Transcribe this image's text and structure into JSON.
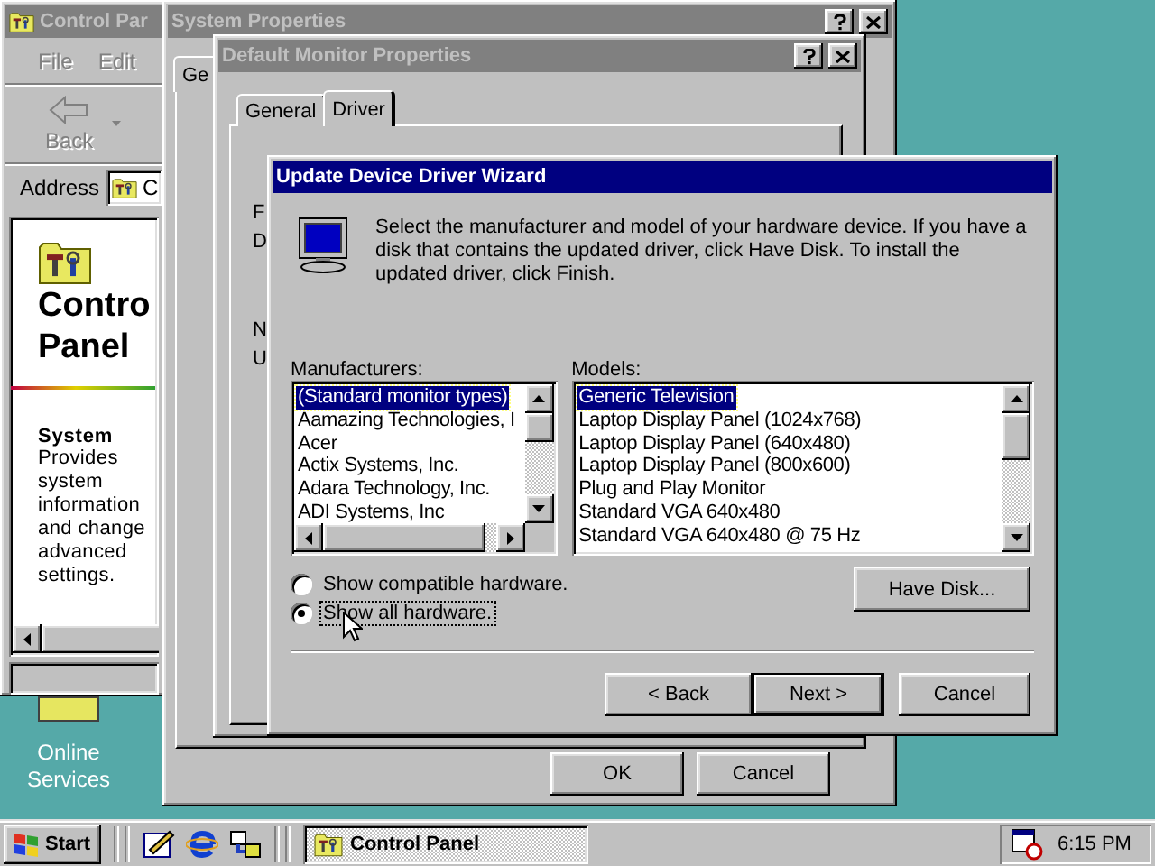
{
  "desktop": {
    "icons": [
      {
        "label": "Online Services"
      }
    ]
  },
  "control_panel": {
    "title": "Control Par",
    "menu": [
      {
        "label": "File",
        "disabled": true
      },
      {
        "label": "Edit",
        "disabled": true
      }
    ],
    "toolbar": [
      {
        "label": "Back",
        "disabled": true
      }
    ],
    "address_label": "Address",
    "address_value": "C",
    "heading": [
      "Contro",
      "Panel"
    ],
    "item_title": "System",
    "item_description": "Provides system information and change advanced settings."
  },
  "system_properties": {
    "title": "System Properties",
    "tabs": [
      {
        "label": "Ge",
        "selected": true
      }
    ],
    "buttons": [
      "OK",
      "Cancel"
    ]
  },
  "monitor_properties": {
    "title": "Default Monitor Properties",
    "tabs": [
      {
        "label": "General",
        "selected": false
      },
      {
        "label": "Driver",
        "selected": true
      }
    ],
    "fragments": [
      "F",
      "D",
      "N",
      "U"
    ]
  },
  "wizard": {
    "title": "Update Device Driver Wizard",
    "instructions": "Select the manufacturer and model of your hardware device. If you have a disk that contains the updated driver, click Have Disk. To install the updated driver, click Finish.",
    "manufacturers": {
      "label": "Manufacturers:",
      "items": [
        {
          "text": "(Standard monitor types)",
          "selected": true
        },
        {
          "text": "Aamazing Technologies, I",
          "selected": false
        },
        {
          "text": "Acer",
          "selected": false
        },
        {
          "text": "Actix Systems, Inc.",
          "selected": false
        },
        {
          "text": "Adara Technology, Inc.",
          "selected": false
        },
        {
          "text": "ADI Systems, Inc",
          "selected": false
        }
      ]
    },
    "models": {
      "label": "Models:",
      "items": [
        {
          "text": "Generic Television",
          "selected": true
        },
        {
          "text": "Laptop Display Panel (1024x768)",
          "selected": false
        },
        {
          "text": "Laptop Display Panel (640x480)",
          "selected": false
        },
        {
          "text": "Laptop Display Panel (800x600)",
          "selected": false
        },
        {
          "text": "Plug and Play Monitor",
          "selected": false
        },
        {
          "text": "Standard VGA 640x480",
          "selected": false
        },
        {
          "text": "Standard VGA 640x480 @ 75 Hz",
          "selected": false
        }
      ]
    },
    "options": [
      {
        "label": "Show compatible hardware.",
        "selected": false
      },
      {
        "label": "Show all hardware.",
        "selected": true
      }
    ],
    "have_disk": "Have Disk...",
    "buttons": [
      {
        "label": "< Back",
        "default": false
      },
      {
        "label": "Next >",
        "default": true
      },
      {
        "label": "Cancel",
        "default": false
      }
    ]
  },
  "taskbar": {
    "start": "Start",
    "tasks": [
      {
        "label": "Control Panel",
        "selected": true
      }
    ],
    "clock": "6:15 PM"
  }
}
